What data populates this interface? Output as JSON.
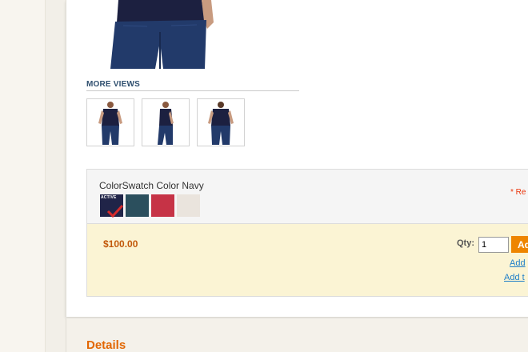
{
  "more_views": {
    "title": "MORE VIEWS"
  },
  "color_swatch": {
    "label": "ColorSwatch Color Navy",
    "active_tag": "ACTIVE",
    "options": [
      {
        "color": "#202448",
        "selected": true
      },
      {
        "color": "#2b4f5d",
        "selected": false
      },
      {
        "color": "#c63346",
        "selected": false
      },
      {
        "color": "#eae4dd",
        "selected": false
      }
    ]
  },
  "required_note": "* Re",
  "price": "$100.00",
  "qty": {
    "label": "Qty:",
    "value": "1"
  },
  "add_button_label": "Ad",
  "links": {
    "add_wishlist": "Add",
    "add_compare": "Add t"
  },
  "details_title": "Details"
}
